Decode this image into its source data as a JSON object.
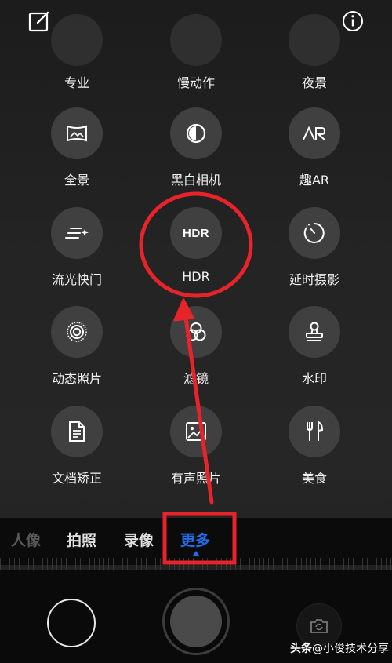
{
  "top": {
    "edit_icon": "edit-note-icon",
    "info_icon": "info-icon"
  },
  "rows": {
    "top_labels": [
      "专业",
      "慢动作",
      "夜景"
    ]
  },
  "modes": [
    {
      "label": "全景",
      "icon": "panorama-icon"
    },
    {
      "label": "黑白相机",
      "icon": "monochrome-icon"
    },
    {
      "label": "趣AR",
      "icon": "ar-icon"
    },
    {
      "label": "流光快门",
      "icon": "light-trail-icon"
    },
    {
      "label": "HDR",
      "icon": "hdr-icon",
      "icon_text": "HDR"
    },
    {
      "label": "延时摄影",
      "icon": "timelapse-icon"
    },
    {
      "label": "动态照片",
      "icon": "live-photo-icon"
    },
    {
      "label": "滤镜",
      "icon": "filter-icon"
    },
    {
      "label": "水印",
      "icon": "watermark-stamp-icon"
    },
    {
      "label": "文档矫正",
      "icon": "document-icon"
    },
    {
      "label": "有声照片",
      "icon": "audio-photo-icon"
    },
    {
      "label": "美食",
      "icon": "food-icon"
    }
  ],
  "tabs": [
    {
      "label": "人像",
      "state": "faded"
    },
    {
      "label": "拍照",
      "state": "normal"
    },
    {
      "label": "录像",
      "state": "normal"
    },
    {
      "label": "更多",
      "state": "active"
    }
  ],
  "colors": {
    "accent": "#1f6ff0",
    "annotation": "#e8232a",
    "background": "#1a1a1a"
  },
  "watermark": {
    "brand": "头条",
    "handle": "@小俊技术分享"
  }
}
